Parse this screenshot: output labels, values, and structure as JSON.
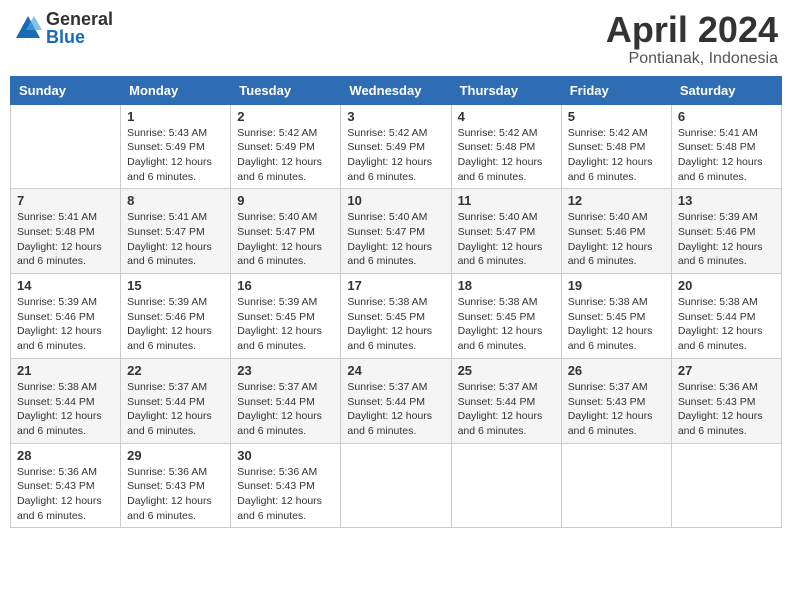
{
  "header": {
    "logo_general": "General",
    "logo_blue": "Blue",
    "month_title": "April 2024",
    "location": "Pontianak, Indonesia"
  },
  "days_of_week": [
    "Sunday",
    "Monday",
    "Tuesday",
    "Wednesday",
    "Thursday",
    "Friday",
    "Saturday"
  ],
  "weeks": [
    [
      {
        "day": "",
        "info": ""
      },
      {
        "day": "1",
        "info": "Sunrise: 5:43 AM\nSunset: 5:49 PM\nDaylight: 12 hours\nand 6 minutes."
      },
      {
        "day": "2",
        "info": "Sunrise: 5:42 AM\nSunset: 5:49 PM\nDaylight: 12 hours\nand 6 minutes."
      },
      {
        "day": "3",
        "info": "Sunrise: 5:42 AM\nSunset: 5:49 PM\nDaylight: 12 hours\nand 6 minutes."
      },
      {
        "day": "4",
        "info": "Sunrise: 5:42 AM\nSunset: 5:48 PM\nDaylight: 12 hours\nand 6 minutes."
      },
      {
        "day": "5",
        "info": "Sunrise: 5:42 AM\nSunset: 5:48 PM\nDaylight: 12 hours\nand 6 minutes."
      },
      {
        "day": "6",
        "info": "Sunrise: 5:41 AM\nSunset: 5:48 PM\nDaylight: 12 hours\nand 6 minutes."
      }
    ],
    [
      {
        "day": "7",
        "info": "Sunrise: 5:41 AM\nSunset: 5:48 PM\nDaylight: 12 hours\nand 6 minutes."
      },
      {
        "day": "8",
        "info": "Sunrise: 5:41 AM\nSunset: 5:47 PM\nDaylight: 12 hours\nand 6 minutes."
      },
      {
        "day": "9",
        "info": "Sunrise: 5:40 AM\nSunset: 5:47 PM\nDaylight: 12 hours\nand 6 minutes."
      },
      {
        "day": "10",
        "info": "Sunrise: 5:40 AM\nSunset: 5:47 PM\nDaylight: 12 hours\nand 6 minutes."
      },
      {
        "day": "11",
        "info": "Sunrise: 5:40 AM\nSunset: 5:47 PM\nDaylight: 12 hours\nand 6 minutes."
      },
      {
        "day": "12",
        "info": "Sunrise: 5:40 AM\nSunset: 5:46 PM\nDaylight: 12 hours\nand 6 minutes."
      },
      {
        "day": "13",
        "info": "Sunrise: 5:39 AM\nSunset: 5:46 PM\nDaylight: 12 hours\nand 6 minutes."
      }
    ],
    [
      {
        "day": "14",
        "info": "Sunrise: 5:39 AM\nSunset: 5:46 PM\nDaylight: 12 hours\nand 6 minutes."
      },
      {
        "day": "15",
        "info": "Sunrise: 5:39 AM\nSunset: 5:46 PM\nDaylight: 12 hours\nand 6 minutes."
      },
      {
        "day": "16",
        "info": "Sunrise: 5:39 AM\nSunset: 5:45 PM\nDaylight: 12 hours\nand 6 minutes."
      },
      {
        "day": "17",
        "info": "Sunrise: 5:38 AM\nSunset: 5:45 PM\nDaylight: 12 hours\nand 6 minutes."
      },
      {
        "day": "18",
        "info": "Sunrise: 5:38 AM\nSunset: 5:45 PM\nDaylight: 12 hours\nand 6 minutes."
      },
      {
        "day": "19",
        "info": "Sunrise: 5:38 AM\nSunset: 5:45 PM\nDaylight: 12 hours\nand 6 minutes."
      },
      {
        "day": "20",
        "info": "Sunrise: 5:38 AM\nSunset: 5:44 PM\nDaylight: 12 hours\nand 6 minutes."
      }
    ],
    [
      {
        "day": "21",
        "info": "Sunrise: 5:38 AM\nSunset: 5:44 PM\nDaylight: 12 hours\nand 6 minutes."
      },
      {
        "day": "22",
        "info": "Sunrise: 5:37 AM\nSunset: 5:44 PM\nDaylight: 12 hours\nand 6 minutes."
      },
      {
        "day": "23",
        "info": "Sunrise: 5:37 AM\nSunset: 5:44 PM\nDaylight: 12 hours\nand 6 minutes."
      },
      {
        "day": "24",
        "info": "Sunrise: 5:37 AM\nSunset: 5:44 PM\nDaylight: 12 hours\nand 6 minutes."
      },
      {
        "day": "25",
        "info": "Sunrise: 5:37 AM\nSunset: 5:44 PM\nDaylight: 12 hours\nand 6 minutes."
      },
      {
        "day": "26",
        "info": "Sunrise: 5:37 AM\nSunset: 5:43 PM\nDaylight: 12 hours\nand 6 minutes."
      },
      {
        "day": "27",
        "info": "Sunrise: 5:36 AM\nSunset: 5:43 PM\nDaylight: 12 hours\nand 6 minutes."
      }
    ],
    [
      {
        "day": "28",
        "info": "Sunrise: 5:36 AM\nSunset: 5:43 PM\nDaylight: 12 hours\nand 6 minutes."
      },
      {
        "day": "29",
        "info": "Sunrise: 5:36 AM\nSunset: 5:43 PM\nDaylight: 12 hours\nand 6 minutes."
      },
      {
        "day": "30",
        "info": "Sunrise: 5:36 AM\nSunset: 5:43 PM\nDaylight: 12 hours\nand 6 minutes."
      },
      {
        "day": "",
        "info": ""
      },
      {
        "day": "",
        "info": ""
      },
      {
        "day": "",
        "info": ""
      },
      {
        "day": "",
        "info": ""
      }
    ]
  ]
}
